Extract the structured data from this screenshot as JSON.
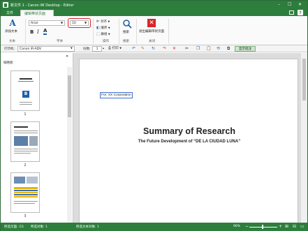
{
  "window": {
    "title": "新文件 1 - Canon iW Desktop - Editor",
    "min": "–",
    "max": "□",
    "close": "✕"
  },
  "menu": {
    "file": "文件",
    "tab_active": "编辑带状页面",
    "help": "?"
  },
  "ribbon": {
    "add_text": "添加文本",
    "font_name": "Arial",
    "font_size": "10",
    "bold": "B",
    "italic": "I",
    "text_color": "A",
    "align": "对齐",
    "order": "顺序",
    "group": "群组",
    "search": "搜索",
    "exit_mode": "退出编辑带状页面",
    "groups": {
      "text": "文本",
      "font": "字体",
      "operation": "操作",
      "search": "搜索",
      "close": "关闭"
    }
  },
  "toolbar2": {
    "printer_label": "打印机:",
    "printer": "Canon iR-ADV",
    "copies_label": "份数:",
    "copies": "1",
    "print": "打印",
    "annotation": "显示批注"
  },
  "left_pane": {
    "title": "缩略图",
    "close": "✕",
    "pages": [
      "1",
      "2",
      "3"
    ]
  },
  "document": {
    "textbox": "For: XX Corporation",
    "title": "Summary of Research",
    "subtitle": "The Future Development of “DE LA CIUDAD LUNA”"
  },
  "status": {
    "pages": "所选页面: /11",
    "selected": "所选对象: 1",
    "selected_text": "所选文本对象: 1",
    "zoom": "90%"
  },
  "colors": {
    "accent": "#2d7d3d",
    "highlight": "#d62828"
  }
}
